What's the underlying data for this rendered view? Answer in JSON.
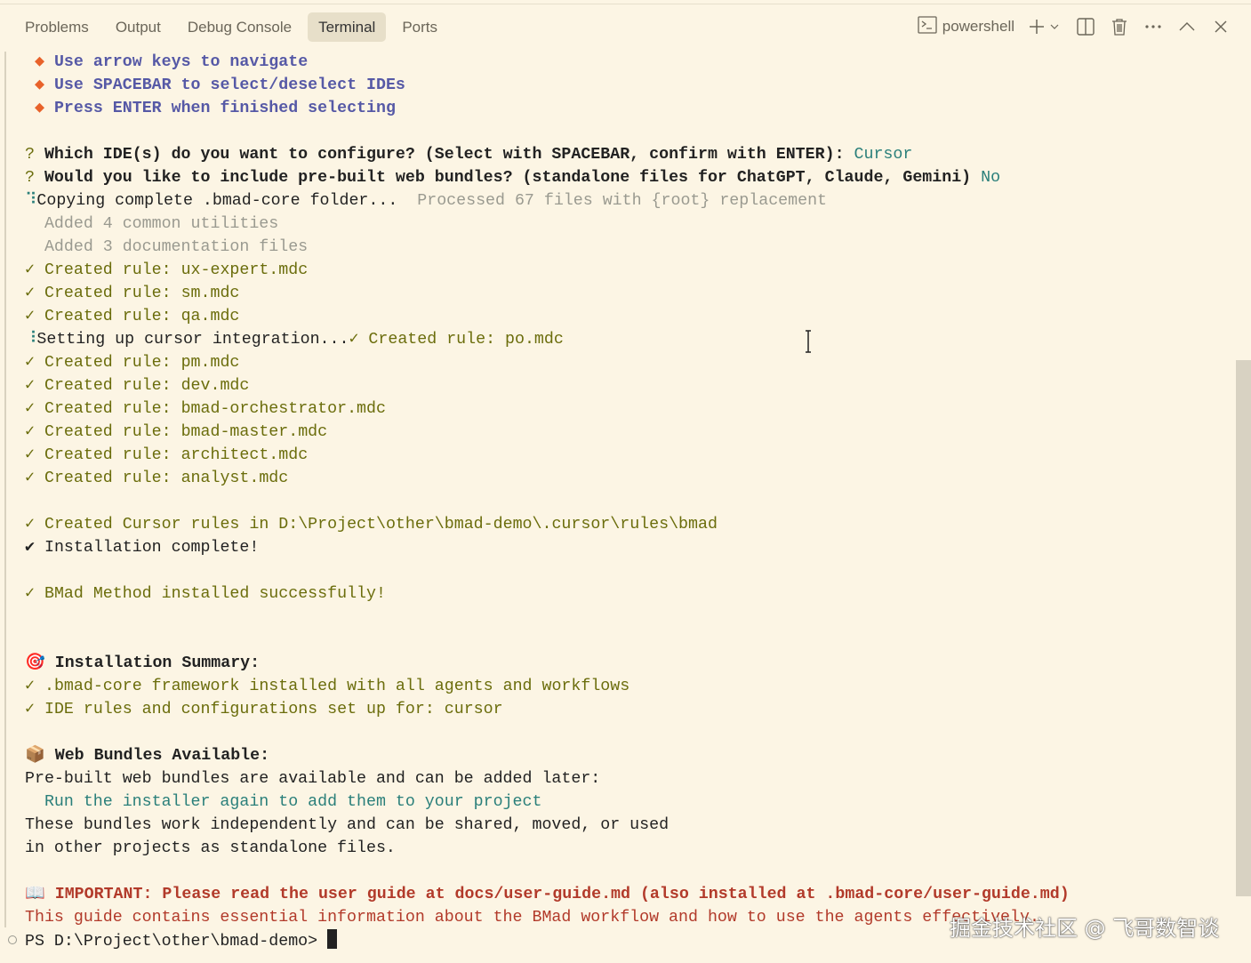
{
  "tabs": [
    "Problems",
    "Output",
    "Debug Console",
    "Terminal",
    "Ports"
  ],
  "active_tab": "Terminal",
  "actions": {
    "shell": "powershell"
  },
  "colors": {
    "background": "#fcf5e4",
    "green": "#6b6d0c",
    "teal": "#2a7f7a",
    "blue": "#5659a6",
    "orange": "#e8622a",
    "red": "#b23a2a"
  },
  "terminal": {
    "lines": [
      [
        {
          "t": " ◆ ",
          "c": "c-orange"
        },
        {
          "t": "Use arrow keys to navigate",
          "c": "c-blue"
        }
      ],
      [
        {
          "t": " ◆ ",
          "c": "c-orange"
        },
        {
          "t": "Use SPACEBAR to select/deselect IDEs",
          "c": "c-blue"
        }
      ],
      [
        {
          "t": " ◆ ",
          "c": "c-orange"
        },
        {
          "t": "Press ENTER when finished selecting",
          "c": "c-blue"
        }
      ],
      [],
      [
        {
          "t": "? ",
          "c": "c-green"
        },
        {
          "t": "Which IDE(s) do you want to configure? (Select with SPACEBAR, confirm with ENTER): ",
          "c": "c-bold"
        },
        {
          "t": "Cursor",
          "c": "c-teal"
        }
      ],
      [
        {
          "t": "? ",
          "c": "c-green"
        },
        {
          "t": "Would you like to include pre-built web bundles? (standalone files for ChatGPT, Claude, Gemini) ",
          "c": "c-bold"
        },
        {
          "t": "No",
          "c": "c-teal"
        }
      ],
      [
        {
          "t": "⠹",
          "c": "c-teal"
        },
        {
          "t": "Copying complete .bmad-core folder...  ",
          "c": ""
        },
        {
          "t": "Processed 67 files with {root} replacement",
          "c": "c-gray"
        }
      ],
      [
        {
          "t": "  Added 4 common utilities",
          "c": "c-gray"
        }
      ],
      [
        {
          "t": "  Added 3 documentation files",
          "c": "c-gray"
        }
      ],
      [
        {
          "t": "✓ Created rule: ux-expert.mdc",
          "c": "c-green"
        }
      ],
      [
        {
          "t": "✓ Created rule: sm.mdc",
          "c": "c-green"
        }
      ],
      [
        {
          "t": "✓ Created rule: qa.mdc",
          "c": "c-green"
        }
      ],
      [
        {
          "t": "⠸",
          "c": "c-teal"
        },
        {
          "t": "Setting up cursor integration...",
          "c": ""
        },
        {
          "t": "✓ Created rule: po.mdc",
          "c": "c-green"
        }
      ],
      [
        {
          "t": "✓ Created rule: pm.mdc",
          "c": "c-green"
        }
      ],
      [
        {
          "t": "✓ Created rule: dev.mdc",
          "c": "c-green"
        }
      ],
      [
        {
          "t": "✓ Created rule: bmad-orchestrator.mdc",
          "c": "c-green"
        }
      ],
      [
        {
          "t": "✓ Created rule: bmad-master.mdc",
          "c": "c-green"
        }
      ],
      [
        {
          "t": "✓ Created rule: architect.mdc",
          "c": "c-green"
        }
      ],
      [
        {
          "t": "✓ Created rule: analyst.mdc",
          "c": "c-green"
        }
      ],
      [],
      [
        {
          "t": "✓ Created Cursor rules in D:\\Project\\other\\bmad-demo\\.cursor\\rules\\bmad",
          "c": "c-green"
        }
      ],
      [
        {
          "t": "✔ ",
          "c": "c-bold"
        },
        {
          "t": "Installation complete!",
          "c": ""
        }
      ],
      [],
      [
        {
          "t": "✓ BMad Method installed successfully!",
          "c": "c-green"
        }
      ],
      [],
      [],
      [
        {
          "t": "🎯 ",
          "c": ""
        },
        {
          "t": "Installation Summary:",
          "c": "c-bold"
        }
      ],
      [
        {
          "t": "✓ .bmad-core framework installed with all agents and workflows",
          "c": "c-green"
        }
      ],
      [
        {
          "t": "✓ IDE rules and configurations set up for: cursor",
          "c": "c-green"
        }
      ],
      [],
      [
        {
          "t": "📦 ",
          "c": ""
        },
        {
          "t": "Web Bundles Available:",
          "c": "c-bold"
        }
      ],
      [
        {
          "t": "Pre-built web bundles are available and can be added later:",
          "c": ""
        }
      ],
      [
        {
          "t": "  Run the installer again to add them to your project",
          "c": "c-teal"
        }
      ],
      [
        {
          "t": "These bundles work independently and can be shared, moved, or used",
          "c": ""
        }
      ],
      [
        {
          "t": "in other projects as standalone files.",
          "c": ""
        }
      ],
      [],
      [
        {
          "t": "📖 ",
          "c": ""
        },
        {
          "t": "IMPORTANT: Please read the user guide at docs/user-guide.md (also installed at .bmad-core/user-guide.md)",
          "c": "c-redb"
        }
      ],
      [
        {
          "t": "This guide contains essential information about the BMad workflow and how to use the agents effectively.",
          "c": "c-red"
        }
      ],
      [
        {
          "t": "PS D:\\Project\\other\\bmad-demo> ",
          "c": ""
        }
      ]
    ]
  },
  "watermark": "掘金技术社区 @ 飞哥数智谈"
}
